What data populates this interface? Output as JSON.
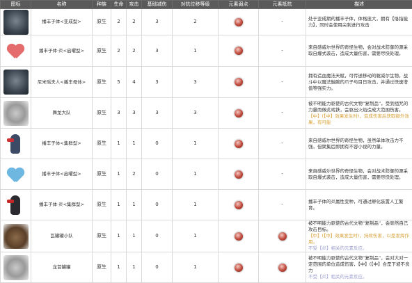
{
  "headers": [
    "图标",
    "名称",
    "种族",
    "生命",
    "攻击",
    "基础减伤",
    "对抗位移等级",
    "元素弱点",
    "元素抵抗",
    "描述"
  ],
  "rows": [
    {
      "icon": "dark-beast-icon",
      "name": "播丰子体<亚成型>",
      "race": "原生",
      "hp": "2",
      "atk": "2",
      "def": "3",
      "lvl": "2",
      "weak": "fire",
      "resist": "-",
      "desc": [
        "处于亚成期的播丰子体，体格庞大，拥有【恪指能力】，同时会使用尖刺进行攻击",
        ""
      ]
    },
    {
      "icon": "red-heart-icon",
      "name": "播丰子体·炎<启曜型>",
      "race": "原生",
      "hp": "2",
      "atk": "2",
      "def": "3",
      "lvl": "1",
      "weak": "fire",
      "resist": "-",
      "desc": [
        "来自感威尔世界的奇怪生物，会对战术防御的源采取自爆式袭击，造成大量伤害，需要尽快处理。",
        ""
      ]
    },
    {
      "icon": "dark-matron-icon",
      "name": "尼米瑶夫人<播丰母体>",
      "race": "原生",
      "hp": "5",
      "atk": "4",
      "def": "3",
      "lvl": "3",
      "weak": "fire",
      "resist": "-",
      "desc": [
        "拥有造血魔法天赋，可传送移动的躯威尔生物。战斗中以魔法触腕的爪子与目日攻击，并通过快速增值等强实力。",
        ""
      ]
    },
    {
      "icon": "dragon-dance-icon",
      "name": "舞龙大队",
      "race": "原生",
      "hp": "3",
      "atk": "3",
      "def": "3",
      "lvl": "3",
      "weak": "fire",
      "resist": "-",
      "desc": [
        "被不明能力驱使的古代文物“复制品”，受到组咒的力量而做此戏铁，会驱出火焰造成大范围伤害。",
        "【中】(【中】效果发生时)，造成伤害后获取额外效果，有可能",
        ""
      ]
    },
    {
      "icon": "blue-bird-icon",
      "name": "播丰子体<集群型>",
      "race": "原生",
      "hp": "1",
      "atk": "1",
      "def": "0",
      "lvl": "1",
      "weak": "fire",
      "resist": "-",
      "desc": [
        "来自感威尔世界的奇怪生物，虽然单体攻击力不强，但聚集后即拥有不容小视的力量。",
        ""
      ]
    },
    {
      "icon": "blue-heart-icon",
      "name": "播丰子体<启曜型>",
      "race": "原生",
      "hp": "1",
      "atk": "2",
      "def": "0",
      "lvl": "1",
      "weak": "fire",
      "resist": "-",
      "desc": [
        "来自感威尔世界的奇怪生物，会对战术防御的源采取自爆式袭击，造成大量伤害，需要尽快处理。",
        ""
      ]
    },
    {
      "icon": "red-bird-icon",
      "name": "播丰子体·炎<集群型>",
      "race": "原生",
      "hp": "1",
      "atk": "1",
      "def": "0",
      "lvl": "1",
      "weak": "fire",
      "resist": "-",
      "desc": [
        "播丰子体的炎属性变种，可通过孵化装置人工繁育。",
        ""
      ]
    },
    {
      "icon": "clay-pot-icon",
      "name": "瓦罐罐小队",
      "race": "原生",
      "hp": "1",
      "atk": "1",
      "def": "0",
      "lvl": "1",
      "weak": "fire",
      "resist": "fire",
      "desc": [
        "被不明能力驱使的古代文物“复制品”，会顽然自己攻击目标。",
        "【中】(【中】效果发生时)，持续伤害，以是发挥作用。",
        "不受【炎】相关的元素反应。"
      ]
    },
    {
      "icon": "dragon-pot-icon",
      "name": "龙首罐罐",
      "race": "原生",
      "hp": "1",
      "atk": "1",
      "def": "0",
      "lvl": "1",
      "weak": "fire",
      "resist": "fire",
      "desc": [
        "被不明能力驱使的古代文物“复制品”，会对大对一定范围的单位造成伤害，【中】(【中】合是下坡不良力",
        "不受【炎】相关的元素反应。",
        ""
      ]
    }
  ]
}
